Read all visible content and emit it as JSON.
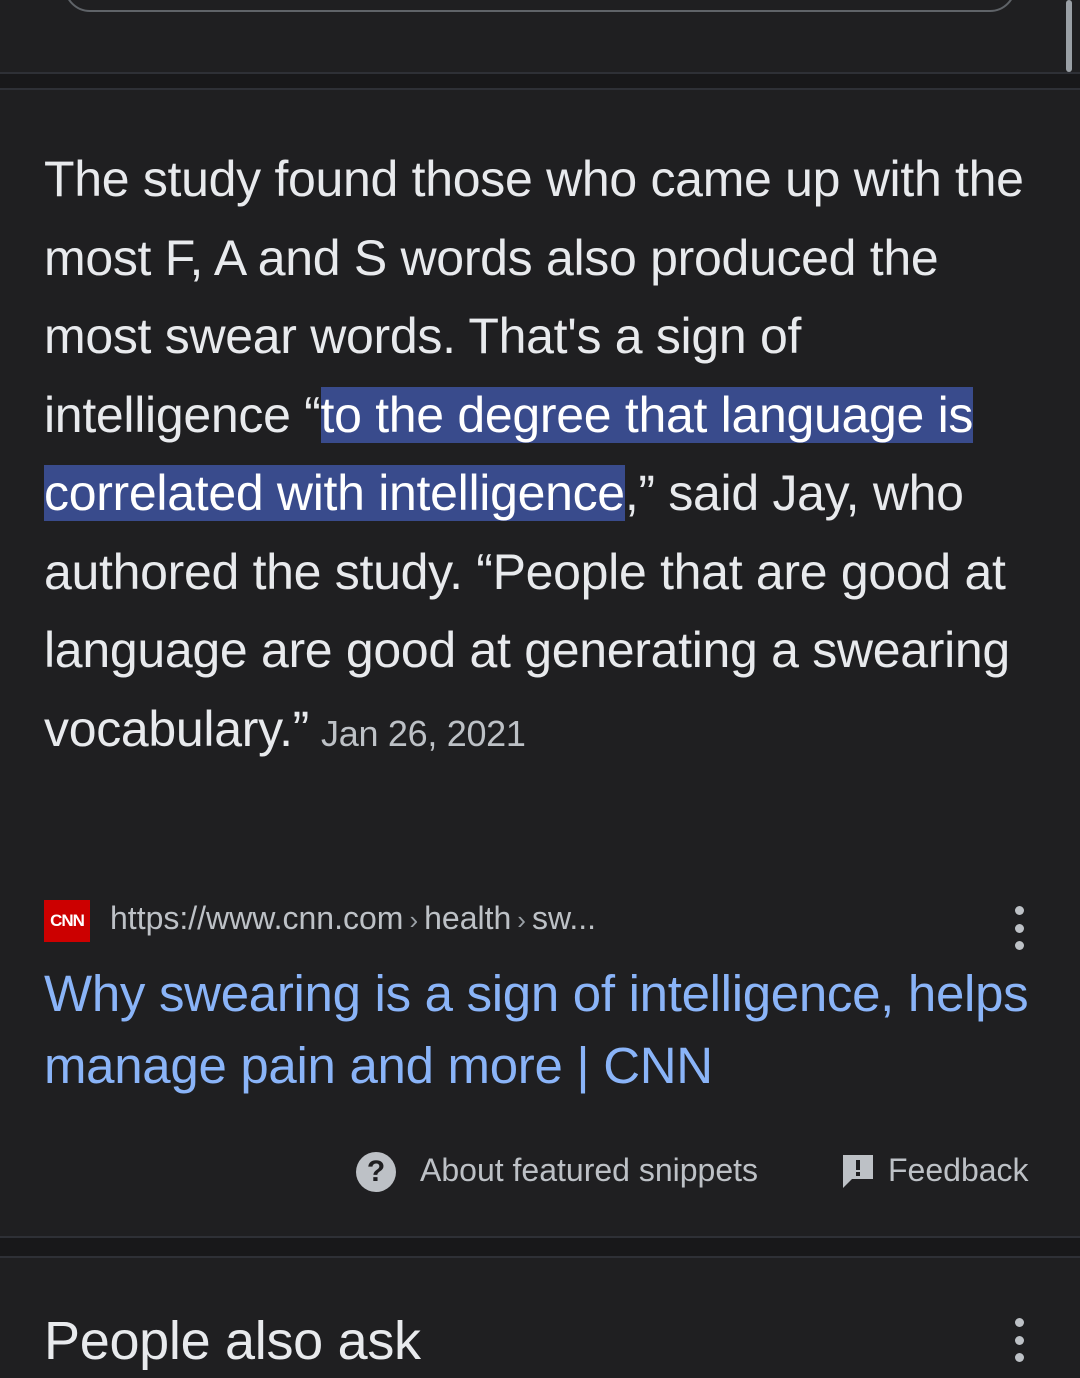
{
  "snippet": {
    "text_before": "The study found those who came up with the most F, A and S words also produced the most swear words. That's a sign of intelligence “",
    "highlight": "to the degree that language is correlated with intelligence",
    "text_after": ",” said Jay, who authored the study. “People that are good at language are good at generating a swearing vocabulary.”",
    "date": "Jan 26, 2021"
  },
  "source": {
    "favicon_text": "CNN",
    "url_base": "https://www.cnn.com",
    "url_path_1": "health",
    "url_path_2": "sw...",
    "separator": "›",
    "title": "Why swearing is a sign of intelligence, helps manage pain and more | CNN"
  },
  "footer": {
    "about_label": "About featured snippets",
    "help_glyph": "?",
    "feedback_label": "Feedback"
  },
  "people_also_ask": {
    "title": "People also ask"
  },
  "colors": {
    "background": "#1f1f21",
    "text": "#e8eaed",
    "link": "#8ab4f8",
    "highlight": "#394b8c",
    "cnn_red": "#cc0000"
  }
}
